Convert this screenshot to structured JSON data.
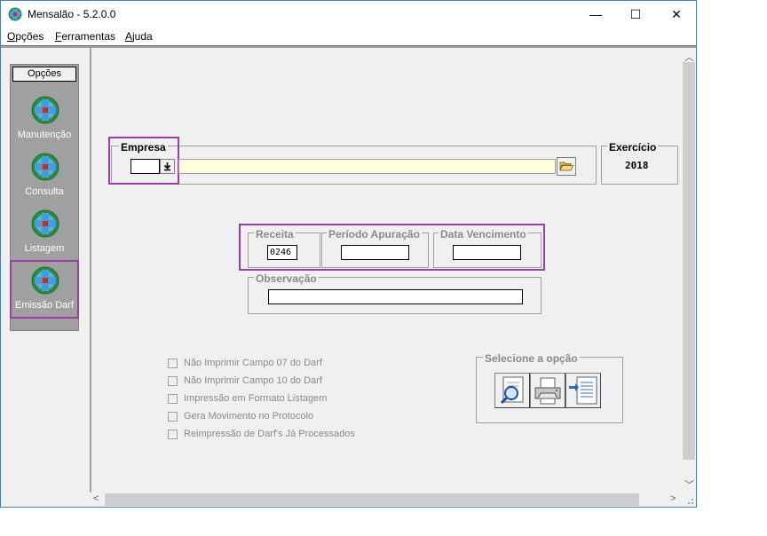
{
  "window": {
    "title": "Mensalão - 5.2.0.0",
    "minimize": "—",
    "maximize": "☐",
    "close": "✕"
  },
  "menu": {
    "opcoes_first": "O",
    "opcoes_rest": "pções",
    "ferramentas_first": "F",
    "ferramentas_rest": "erramentas",
    "ajuda_first": "A",
    "ajuda_rest": "juda"
  },
  "sidebar": {
    "header": "Opções",
    "items": [
      {
        "label": "Manutenção",
        "icon": "globe-icon"
      },
      {
        "label": "Consulta",
        "icon": "globe-icon"
      },
      {
        "label": "Listagem",
        "icon": "globe-icon"
      },
      {
        "label": "Emissão Darf",
        "icon": "globe-icon"
      }
    ]
  },
  "empresa": {
    "label": "Empresa",
    "code_value": "",
    "name_value": "",
    "dropdown_icon": "download-arrow-icon",
    "browse_icon": "folder-open-icon"
  },
  "exercicio": {
    "label": "Exercício",
    "value": "2018"
  },
  "receita": {
    "label": "Receita",
    "value": "0246"
  },
  "periodo": {
    "label": "Período Apuração",
    "value": ""
  },
  "vencimento": {
    "label": "Data Vencimento",
    "value": ""
  },
  "observacao": {
    "label": "Observação",
    "value": ""
  },
  "checkboxes": [
    {
      "label": "Não Imprimir Campo 07 do Darf",
      "checked": false
    },
    {
      "label": "Não Imprimir Campo 10 do Darf",
      "checked": false
    },
    {
      "label": "Impressão em Formato Listagem",
      "checked": false
    },
    {
      "label": "Gera Movimento no Protocolo",
      "checked": false
    },
    {
      "label": "Reimpressão de Darf's Já Processados",
      "checked": false
    }
  ],
  "selecione": {
    "label": "Selecione a opção",
    "buttons": [
      {
        "icon": "magnifier-preview-icon"
      },
      {
        "icon": "printer-icon"
      },
      {
        "icon": "export-document-icon"
      }
    ]
  },
  "colors": {
    "highlight": "#9b3ea6",
    "empresa_field": "#ffffe0",
    "disabled_text": "#8a8a8a"
  }
}
